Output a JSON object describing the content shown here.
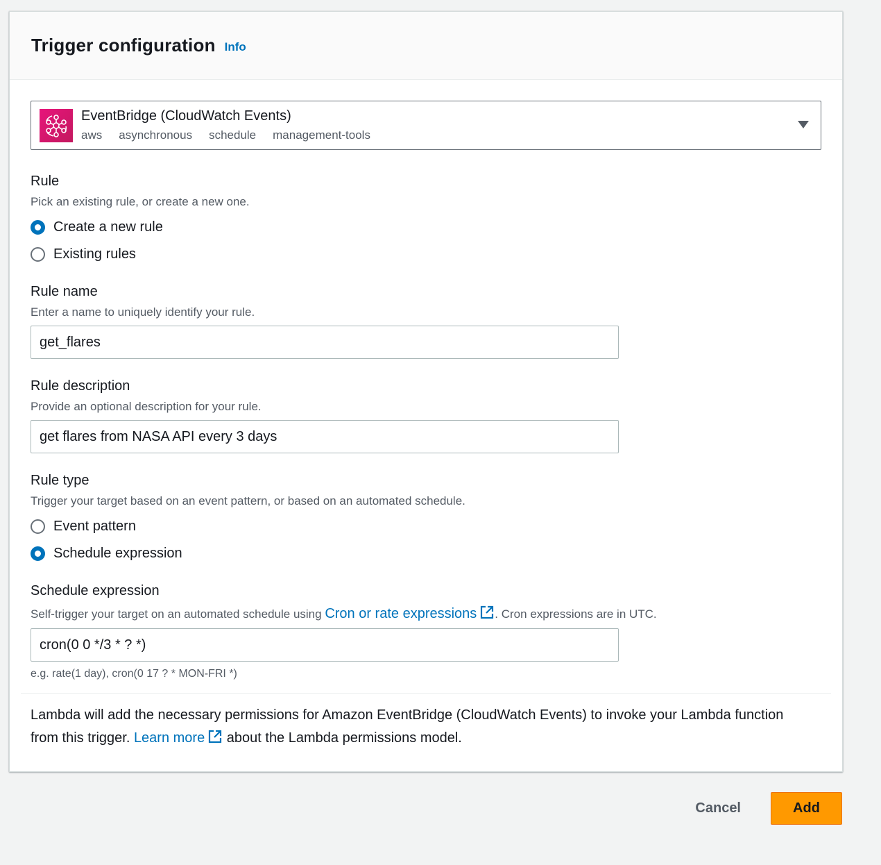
{
  "header": {
    "title": "Trigger configuration",
    "info_label": "Info"
  },
  "trigger": {
    "service_name": "EventBridge (CloudWatch Events)",
    "tags": [
      "aws",
      "asynchronous",
      "schedule",
      "management-tools"
    ],
    "icon": "eventbridge-icon",
    "icon_color": "#e7157b"
  },
  "rule": {
    "label": "Rule",
    "description": "Pick an existing rule, or create a new one.",
    "options": [
      {
        "label": "Create a new rule",
        "checked": true
      },
      {
        "label": "Existing rules",
        "checked": false
      }
    ]
  },
  "rule_name": {
    "label": "Rule name",
    "description": "Enter a name to uniquely identify your rule.",
    "value": "get_flares"
  },
  "rule_description": {
    "label": "Rule description",
    "description": "Provide an optional description for your rule.",
    "value": "get flares from NASA API every 3 days"
  },
  "rule_type": {
    "label": "Rule type",
    "description": "Trigger your target based on an event pattern, or based on an automated schedule.",
    "options": [
      {
        "label": "Event pattern",
        "checked": false
      },
      {
        "label": "Schedule expression",
        "checked": true
      }
    ]
  },
  "schedule": {
    "label": "Schedule expression",
    "description_prefix": "Self-trigger your target on an automated schedule using ",
    "link_label": "Cron or rate expressions",
    "description_suffix": ". Cron expressions are in UTC.",
    "value": "cron(0 0 */3 * ? *)",
    "hint": "e.g. rate(1 day), cron(0 17 ? * MON-FRI *)"
  },
  "permissions": {
    "text_prefix": "Lambda will add the necessary permissions for Amazon EventBridge (CloudWatch Events) to invoke your Lambda function from this trigger. ",
    "link_label": "Learn more",
    "text_suffix": " about the Lambda permissions model."
  },
  "footer": {
    "cancel_label": "Cancel",
    "add_label": "Add"
  },
  "colors": {
    "accent": "#0073bb",
    "primary_button": "#ff9900"
  }
}
